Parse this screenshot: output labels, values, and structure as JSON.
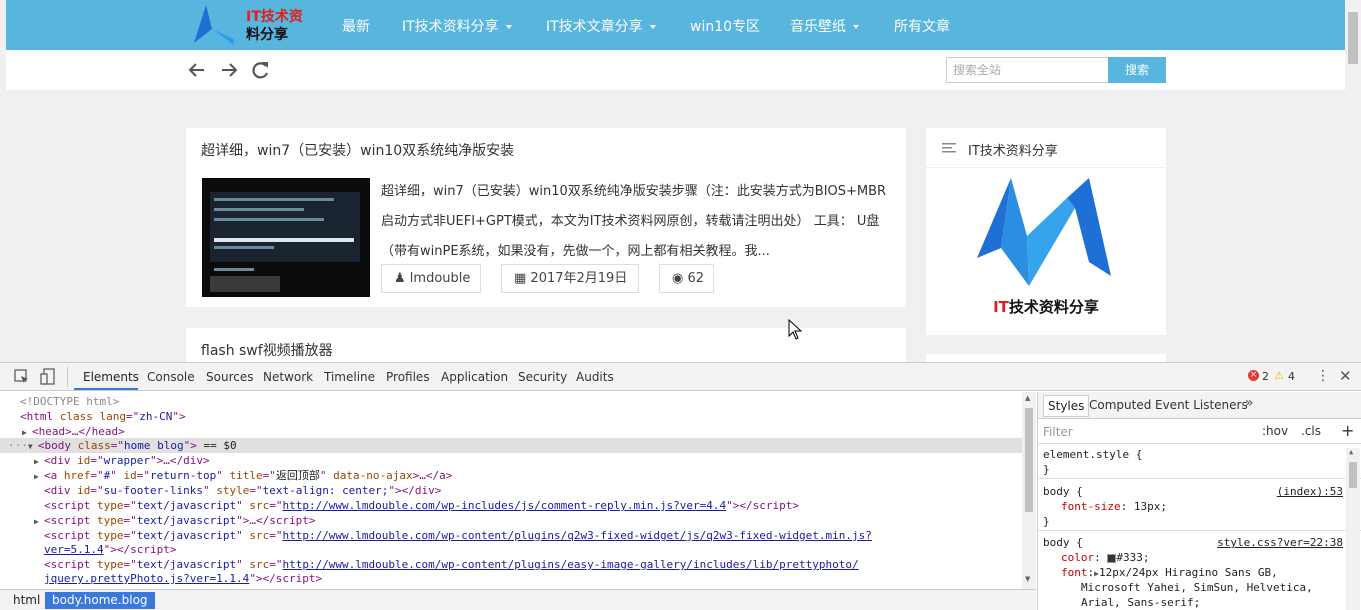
{
  "site": {
    "logo_text_1": "IT技术资",
    "logo_text_2": "料分享",
    "nav": [
      {
        "label": "最新",
        "dropdown": false
      },
      {
        "label": "IT技术资料分享",
        "dropdown": true
      },
      {
        "label": "IT技术文章分享",
        "dropdown": true
      },
      {
        "label": "win10专区",
        "dropdown": false
      },
      {
        "label": "音乐壁纸",
        "dropdown": true
      },
      {
        "label": "所有文章",
        "dropdown": false
      }
    ],
    "search": {
      "placeholder": "搜索全站",
      "button": "搜索"
    }
  },
  "posts": [
    {
      "title": "超详细，win7（已安装）win10双系统纯净版安装",
      "excerpt_lines": [
        "超详细，win7（已安装）win10双系统纯净版安装步骤（注：此安装方式为BIOS+MBR",
        "启动方式非UEFI+GPT模式，本文为IT技术资料网原创，转载请注明出处） 工具： U盘",
        "（带有winPE系统，如果没有，先做一个，网上都有相关教程。我..."
      ],
      "author": "lmdouble",
      "date": "2017年2月19日",
      "views": "62"
    },
    {
      "title": "flash swf视频播放器"
    }
  ],
  "widget": {
    "title": "IT技术资料分享",
    "logo_caption": "IT技术资料分享"
  },
  "devtools": {
    "tabs": [
      "Elements",
      "Console",
      "Sources",
      "Network",
      "Timeline",
      "Profiles",
      "Application",
      "Security",
      "Audits"
    ],
    "active_tab": "Elements",
    "errors": "2",
    "warnings": "4",
    "dom": {
      "doctype": "<!DOCTYPE html>",
      "html_open": {
        "tag": "html",
        "attr": "class",
        "lang_attr": "lang",
        "lang_val": "zh-CN"
      },
      "head": "<head>…</head>",
      "body_class": "home blog",
      "body_suffix": "== $0",
      "wrapper_id": "wrapper",
      "a_href": "#",
      "a_id": "return-top",
      "a_title": "返回顶部",
      "a_extra": "data-no-ajax",
      "footer_div_id": "su-footer-links",
      "footer_div_style": "text-align: center;",
      "script_type": "text/javascript",
      "script_1": "http://www.lmdouble.com/wp-includes/js/comment-reply.min.js?ver=4.4",
      "script_3a": "http://www.lmdouble.com/wp-content/plugins/q2w3-fixed-widget/js/q2w3-fixed-widget.min.js?",
      "script_3b": "ver=5.1.4",
      "script_4a": "http://www.lmdouble.com/wp-content/plugins/easy-image-gallery/includes/lib/prettyphoto/",
      "script_4b": "jquery.prettyPhoto.js?ver=1.1.4"
    },
    "crumbs": [
      "html",
      "body.home.blog"
    ],
    "styles_tabs": [
      "Styles",
      "Computed",
      "Event Listeners"
    ],
    "filter_placeholder": "Filter",
    "hov": ":hov",
    "cls": ".cls",
    "rules": {
      "element_style": "element.style {",
      "body1_sel": "body {",
      "body1_src": "(index):53",
      "body1_prop": "font-size",
      "body1_val": "13px;",
      "body2_sel": "body {",
      "body2_src": "style.css?ver=22:38",
      "color_prop": "color",
      "color_val": "#333;",
      "font_prop": "font",
      "font_val_1": "12px/24px Hiragino Sans GB,",
      "font_val_2": "Microsoft Yahei, SimSun, Helvetica,",
      "font_val_3": "Arial, Sans-serif;"
    }
  },
  "colors": {
    "header": "#58b5dd",
    "accent_blue": "#3879d9"
  }
}
